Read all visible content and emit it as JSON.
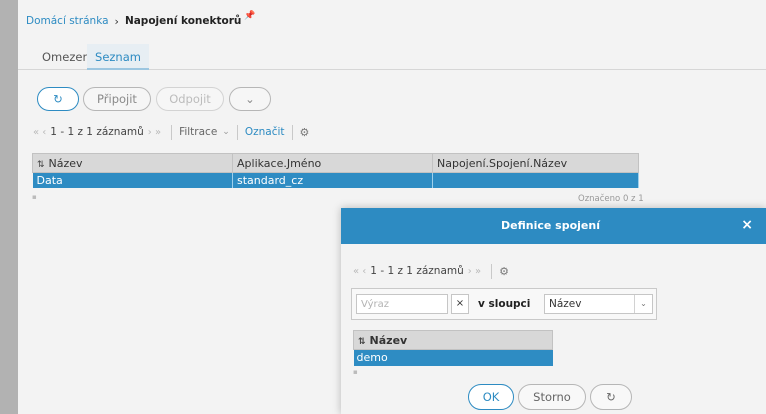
{
  "breadcrumb": {
    "home": "Domácí stránka",
    "separator": "›",
    "current": "Napojení konektorů"
  },
  "tabs": [
    {
      "label": "Omezení",
      "active": false
    },
    {
      "label": "Seznam",
      "active": true
    }
  ],
  "toolbar": {
    "refresh_icon": "↻",
    "connect_label": "Připojit",
    "disconnect_label": "Odpojit",
    "more_icon": "⌄"
  },
  "pager": {
    "first_prev": "« ‹",
    "info": "1 - 1 z 1 záznamů",
    "next_last": "› »",
    "filter_label": "Filtrace",
    "filter_chevron": "⌄",
    "mark_label": "Označit",
    "gear_icon": "⚙"
  },
  "table": {
    "sort_icon": "⇅",
    "columns": [
      "Název",
      "Aplikace.Jméno",
      "Napojení.Spojení.Název"
    ],
    "rows": [
      {
        "nazev": "Data",
        "aplikace": "standard_cz",
        "napojeni": ""
      }
    ],
    "selected_count": "Označeno 0 z 1"
  },
  "dialog": {
    "title": "Definice spojení",
    "close_icon": "×",
    "pager": {
      "first_prev": "« ‹",
      "info": "1 - 1 z 1 záznamů",
      "next_last": "› »",
      "gear_icon": "⚙"
    },
    "filter": {
      "placeholder": "Výraz",
      "clear_icon": "×",
      "column_label": "v sloupci",
      "column_value": "Název",
      "dropdown_icon": "⌄"
    },
    "table": {
      "sort_icon": "⇅",
      "column": "Název",
      "rows": [
        "demo"
      ]
    },
    "buttons": {
      "ok": "OK",
      "cancel": "Storno",
      "refresh_icon": "↻"
    }
  },
  "colors": {
    "accent": "#2d8bc2",
    "selected_row": "#2e8cc3",
    "overlay": "#b2b2b2"
  }
}
